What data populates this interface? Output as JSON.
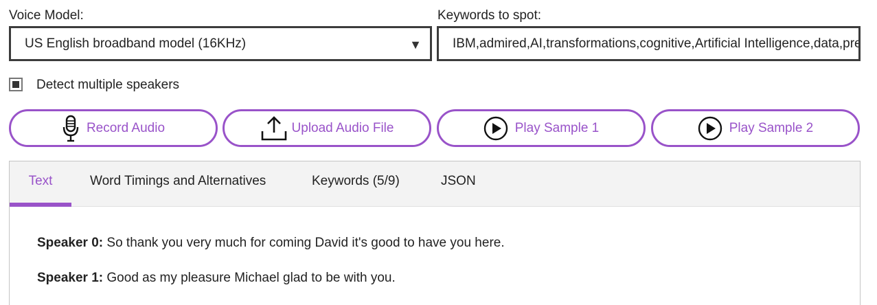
{
  "voice_model": {
    "label": "Voice Model:",
    "selected": "US English broadband model (16KHz)",
    "arrow": "▼"
  },
  "keywords": {
    "label": "Keywords to spot:",
    "value": "IBM,admired,AI,transformations,cognitive,Artificial Intelligence,data,predict,learn"
  },
  "detect_speakers": {
    "label": "Detect multiple speakers",
    "checked": true
  },
  "buttons": {
    "record": {
      "label": "Record Audio",
      "icon": "microphone-icon"
    },
    "upload": {
      "label": "Upload Audio File",
      "icon": "upload-icon"
    },
    "sample1": {
      "label": "Play Sample 1",
      "icon": "play-icon"
    },
    "sample2": {
      "label": "Play Sample 2",
      "icon": "play-icon"
    }
  },
  "tabs": [
    {
      "label": "Text",
      "active": true
    },
    {
      "label": "Word Timings and Alternatives",
      "active": false
    },
    {
      "label": "Keywords (5/9)",
      "active": false
    },
    {
      "label": "JSON",
      "active": false
    }
  ],
  "transcript": [
    {
      "speaker": "Speaker 0:",
      "text": "So thank you very much for coming David it's good to have you here."
    },
    {
      "speaker": "Speaker 1:",
      "text": "Good as my pleasure Michael glad to be with you."
    }
  ],
  "colors": {
    "accent": "#9953c9",
    "border": "#3c3c3c",
    "tabbar_bg": "#f3f3f3"
  }
}
